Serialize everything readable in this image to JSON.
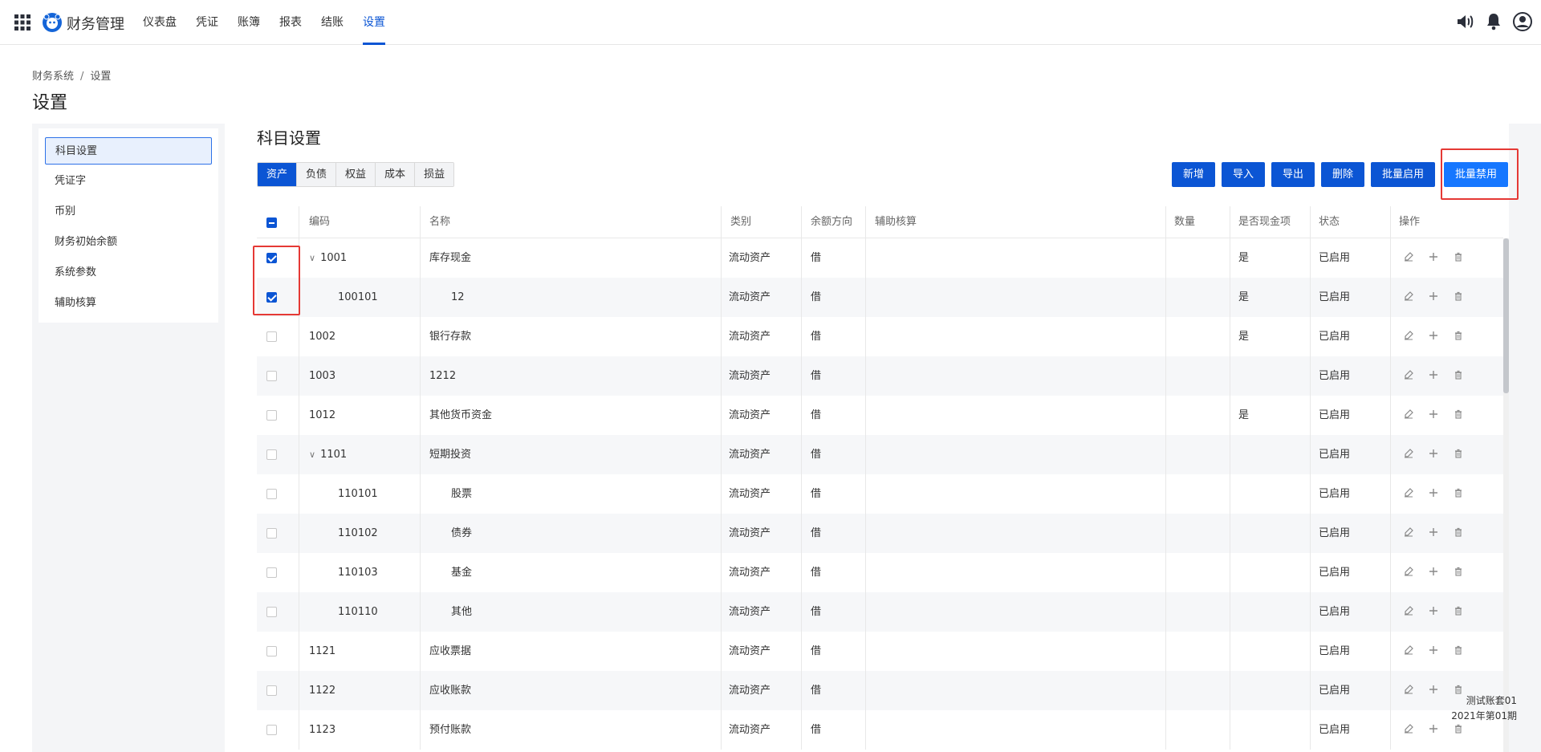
{
  "app": {
    "brand": "财务管理"
  },
  "nav": [
    {
      "label": "仪表盘",
      "active": false
    },
    {
      "label": "凭证",
      "active": false
    },
    {
      "label": "账簿",
      "active": false
    },
    {
      "label": "报表",
      "active": false
    },
    {
      "label": "结账",
      "active": false
    },
    {
      "label": "设置",
      "active": true
    }
  ],
  "breadcrumb": {
    "root": "财务系统",
    "separator": "/",
    "current": "设置"
  },
  "page_title": "设置",
  "sidebar": {
    "items": [
      {
        "label": "科目设置",
        "active": true
      },
      {
        "label": "凭证字",
        "active": false
      },
      {
        "label": "币别",
        "active": false
      },
      {
        "label": "财务初始余额",
        "active": false
      },
      {
        "label": "系统参数",
        "active": false
      },
      {
        "label": "辅助核算",
        "active": false
      }
    ]
  },
  "section_title": "科目设置",
  "tabs": [
    {
      "label": "资产",
      "active": true
    },
    {
      "label": "负债",
      "active": false
    },
    {
      "label": "权益",
      "active": false
    },
    {
      "label": "成本",
      "active": false
    },
    {
      "label": "损益",
      "active": false
    }
  ],
  "toolbar": {
    "add": "新增",
    "import": "导入",
    "export": "导出",
    "delete": "删除",
    "batch_enable": "批量启用",
    "batch_disable": "批量禁用"
  },
  "table": {
    "headers": [
      "编码",
      "名称",
      "类别",
      "余额方向",
      "辅助核算",
      "数量",
      "是否现金项",
      "状态",
      "操作"
    ],
    "header_checkbox": "indeterminate",
    "rows": [
      {
        "checked": true,
        "level": 0,
        "expandable": true,
        "code": "1001",
        "name": "库存现金",
        "category": "流动资产",
        "direction": "借",
        "aux": "",
        "qty": "",
        "cash": "是",
        "status": "已启用"
      },
      {
        "checked": true,
        "level": 1,
        "expandable": false,
        "code": "100101",
        "name": "12",
        "category": "流动资产",
        "direction": "借",
        "aux": "",
        "qty": "",
        "cash": "是",
        "status": "已启用"
      },
      {
        "checked": false,
        "level": 0,
        "expandable": false,
        "code": "1002",
        "name": "银行存款",
        "category": "流动资产",
        "direction": "借",
        "aux": "",
        "qty": "",
        "cash": "是",
        "status": "已启用"
      },
      {
        "checked": false,
        "level": 0,
        "expandable": false,
        "code": "1003",
        "name": "1212",
        "category": "流动资产",
        "direction": "借",
        "aux": "",
        "qty": "",
        "cash": "",
        "status": "已启用"
      },
      {
        "checked": false,
        "level": 0,
        "expandable": false,
        "code": "1012",
        "name": "其他货币资金",
        "category": "流动资产",
        "direction": "借",
        "aux": "",
        "qty": "",
        "cash": "是",
        "status": "已启用"
      },
      {
        "checked": false,
        "level": 0,
        "expandable": true,
        "code": "1101",
        "name": "短期投资",
        "category": "流动资产",
        "direction": "借",
        "aux": "",
        "qty": "",
        "cash": "",
        "status": "已启用"
      },
      {
        "checked": false,
        "level": 1,
        "expandable": false,
        "code": "110101",
        "name": "股票",
        "category": "流动资产",
        "direction": "借",
        "aux": "",
        "qty": "",
        "cash": "",
        "status": "已启用"
      },
      {
        "checked": false,
        "level": 1,
        "expandable": false,
        "code": "110102",
        "name": "债券",
        "category": "流动资产",
        "direction": "借",
        "aux": "",
        "qty": "",
        "cash": "",
        "status": "已启用"
      },
      {
        "checked": false,
        "level": 1,
        "expandable": false,
        "code": "110103",
        "name": "基金",
        "category": "流动资产",
        "direction": "借",
        "aux": "",
        "qty": "",
        "cash": "",
        "status": "已启用"
      },
      {
        "checked": false,
        "level": 1,
        "expandable": false,
        "code": "110110",
        "name": "其他",
        "category": "流动资产",
        "direction": "借",
        "aux": "",
        "qty": "",
        "cash": "",
        "status": "已启用"
      },
      {
        "checked": false,
        "level": 0,
        "expandable": false,
        "code": "1121",
        "name": "应收票据",
        "category": "流动资产",
        "direction": "借",
        "aux": "",
        "qty": "",
        "cash": "",
        "status": "已启用"
      },
      {
        "checked": false,
        "level": 0,
        "expandable": false,
        "code": "1122",
        "name": "应收账款",
        "category": "流动资产",
        "direction": "借",
        "aux": "",
        "qty": "",
        "cash": "",
        "status": "已启用"
      },
      {
        "checked": false,
        "level": 0,
        "expandable": false,
        "code": "1123",
        "name": "预付账款",
        "category": "流动资产",
        "direction": "借",
        "aux": "",
        "qty": "",
        "cash": "",
        "status": "已启用"
      }
    ]
  },
  "footer": {
    "account_set": "测试账套01",
    "period": "2021年第01期"
  },
  "colors": {
    "primary": "#0b55d4",
    "highlight": "#e53935",
    "batch_disable": "#1677ff"
  },
  "icons": [
    "apps-grid-icon",
    "logo-icon",
    "speaker-icon",
    "bell-icon",
    "user-icon",
    "edit-icon",
    "plus-icon",
    "trash-icon",
    "chevron-down-icon"
  ]
}
